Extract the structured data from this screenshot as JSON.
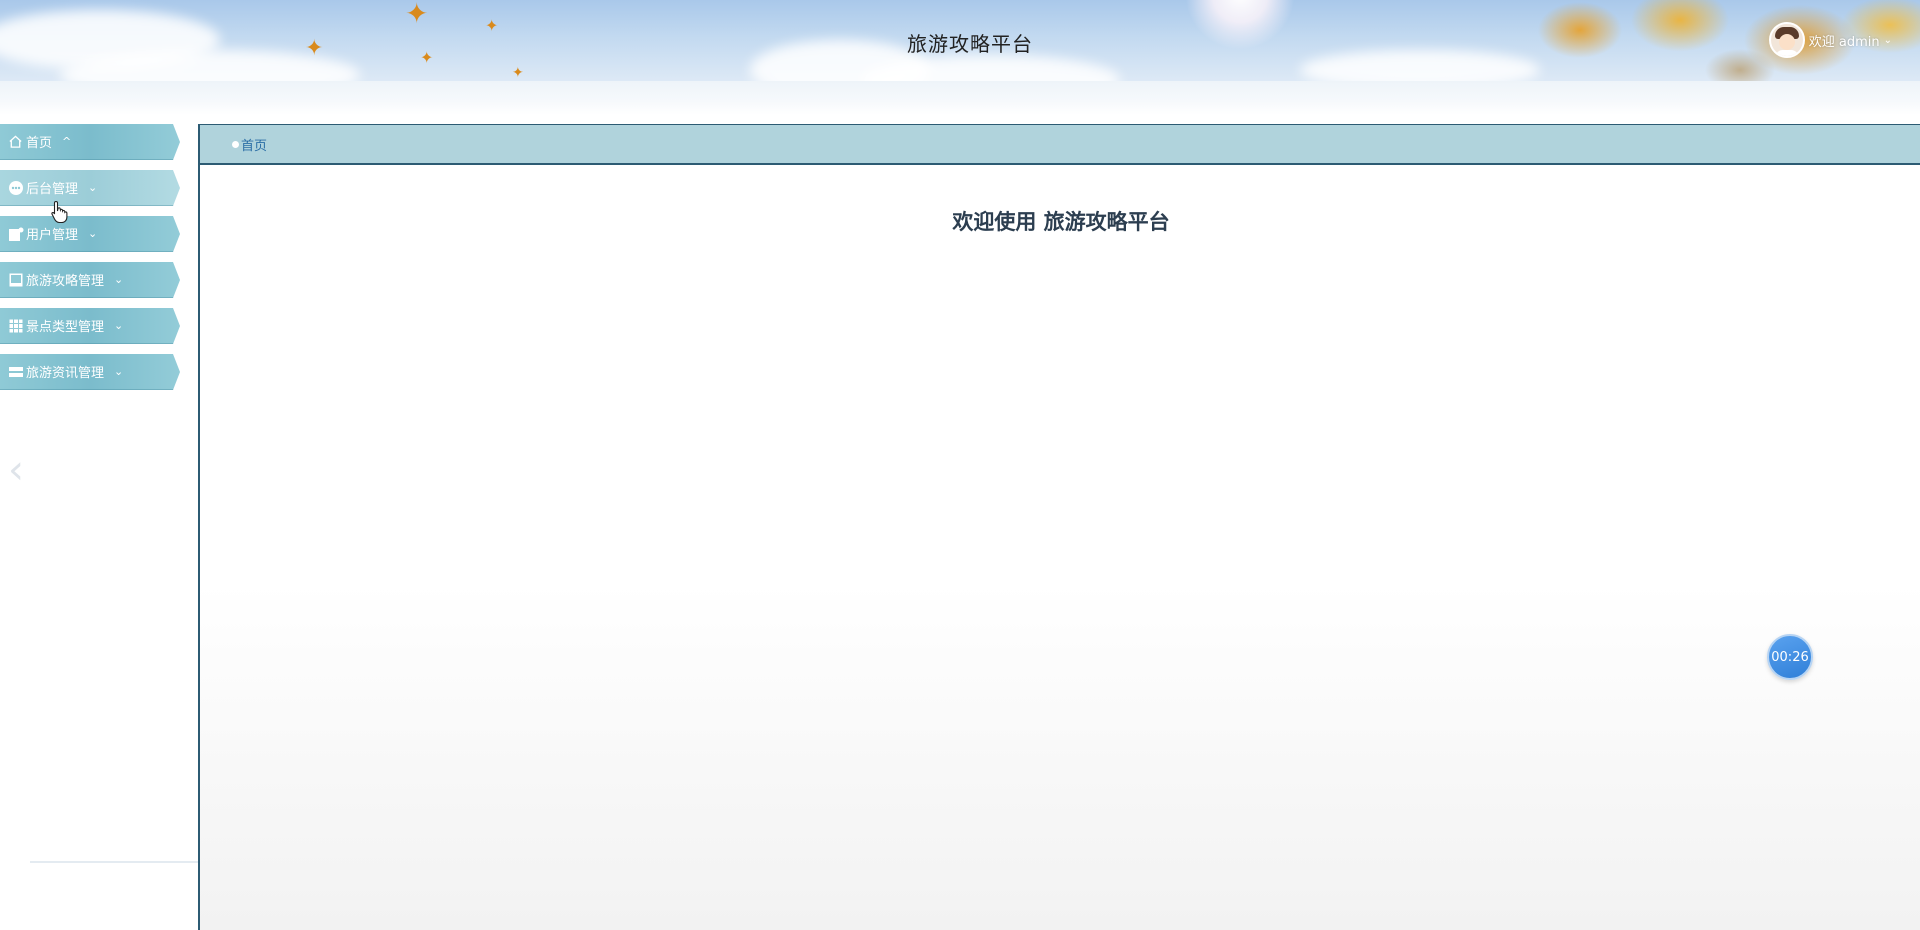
{
  "header": {
    "title": "旅游攻略平台",
    "user": {
      "welcome": "欢迎 admin",
      "avatar_icon": "avatar-icon"
    }
  },
  "sidebar": {
    "items": [
      {
        "label": "首页",
        "icon": "home-icon",
        "caret": "^"
      },
      {
        "label": "后台管理",
        "icon": "admin-icon",
        "caret": "⌄"
      },
      {
        "label": "用户管理",
        "icon": "user-icon",
        "caret": "⌄"
      },
      {
        "label": "旅游攻略管理",
        "icon": "guide-icon",
        "caret": "⌄"
      },
      {
        "label": "景点类型管理",
        "icon": "grid-icon",
        "caret": "⌄"
      },
      {
        "label": "旅游资讯管理",
        "icon": "news-icon",
        "caret": "⌄"
      }
    ]
  },
  "breadcrumb": {
    "items": [
      "首页"
    ]
  },
  "main": {
    "heading": "欢迎使用 旅游攻略平台"
  },
  "timer": {
    "value": "00:26"
  },
  "colors": {
    "menu_teal": "#7bbccc",
    "breadcrumb_bg": "#b0d3dc",
    "border_dark": "#2c5b73",
    "timer_blue": "#2f7fd8",
    "heading": "#2c3e50"
  }
}
